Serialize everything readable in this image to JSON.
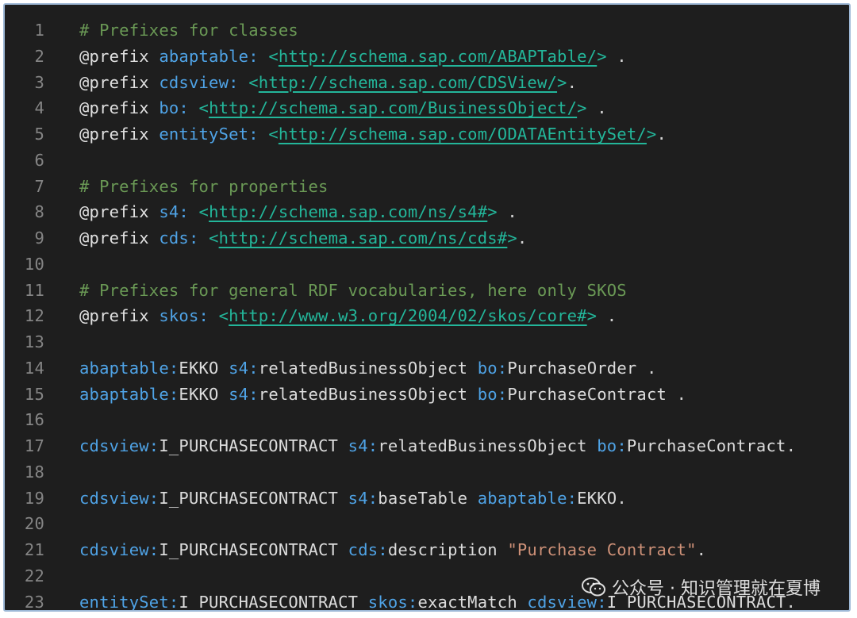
{
  "lines": [
    {
      "num": "1",
      "tokens": [
        {
          "t": "# Prefixes for classes",
          "c": "comment"
        }
      ]
    },
    {
      "num": "2",
      "tokens": [
        {
          "t": "@prefix",
          "c": "kw"
        },
        {
          "t": " ",
          "c": "punct"
        },
        {
          "t": "abaptable:",
          "c": "ns"
        },
        {
          "t": " ",
          "c": "punct"
        },
        {
          "t": "<",
          "c": "bracket"
        },
        {
          "t": "http://schema.sap.com/ABAPTable/",
          "c": "iri"
        },
        {
          "t": ">",
          "c": "bracket"
        },
        {
          "t": " .",
          "c": "punct"
        }
      ]
    },
    {
      "num": "3",
      "tokens": [
        {
          "t": "@prefix",
          "c": "kw"
        },
        {
          "t": " ",
          "c": "punct"
        },
        {
          "t": "cdsview:",
          "c": "ns"
        },
        {
          "t": " ",
          "c": "punct"
        },
        {
          "t": "<",
          "c": "bracket"
        },
        {
          "t": "http://schema.sap.com/CDSView/",
          "c": "iri"
        },
        {
          "t": ">",
          "c": "bracket"
        },
        {
          "t": ".",
          "c": "punct"
        }
      ]
    },
    {
      "num": "4",
      "tokens": [
        {
          "t": "@prefix",
          "c": "kw"
        },
        {
          "t": " ",
          "c": "punct"
        },
        {
          "t": "bo:",
          "c": "ns"
        },
        {
          "t": " ",
          "c": "punct"
        },
        {
          "t": "<",
          "c": "bracket"
        },
        {
          "t": "http://schema.sap.com/BusinessObject/",
          "c": "iri"
        },
        {
          "t": ">",
          "c": "bracket"
        },
        {
          "t": " .",
          "c": "punct"
        }
      ]
    },
    {
      "num": "5",
      "tokens": [
        {
          "t": "@prefix",
          "c": "kw"
        },
        {
          "t": " ",
          "c": "punct"
        },
        {
          "t": "entitySet:",
          "c": "ns"
        },
        {
          "t": " ",
          "c": "punct"
        },
        {
          "t": "<",
          "c": "bracket"
        },
        {
          "t": "http://schema.sap.com/ODATAEntitySet/",
          "c": "iri"
        },
        {
          "t": ">",
          "c": "bracket"
        },
        {
          "t": ".",
          "c": "punct"
        }
      ]
    },
    {
      "num": "6",
      "tokens": []
    },
    {
      "num": "7",
      "tokens": [
        {
          "t": "# Prefixes for properties",
          "c": "comment"
        }
      ]
    },
    {
      "num": "8",
      "tokens": [
        {
          "t": "@prefix",
          "c": "kw"
        },
        {
          "t": " ",
          "c": "punct"
        },
        {
          "t": "s4:",
          "c": "ns"
        },
        {
          "t": " ",
          "c": "punct"
        },
        {
          "t": "<",
          "c": "bracket"
        },
        {
          "t": "http://schema.sap.com/ns/s4#",
          "c": "iri"
        },
        {
          "t": ">",
          "c": "bracket"
        },
        {
          "t": " .",
          "c": "punct"
        }
      ]
    },
    {
      "num": "9",
      "tokens": [
        {
          "t": "@prefix",
          "c": "kw"
        },
        {
          "t": " ",
          "c": "punct"
        },
        {
          "t": "cds:",
          "c": "ns"
        },
        {
          "t": " ",
          "c": "punct"
        },
        {
          "t": "<",
          "c": "bracket"
        },
        {
          "t": "http://schema.sap.com/ns/cds#",
          "c": "iri"
        },
        {
          "t": ">",
          "c": "bracket"
        },
        {
          "t": ".",
          "c": "punct"
        }
      ]
    },
    {
      "num": "10",
      "tokens": []
    },
    {
      "num": "11",
      "tokens": [
        {
          "t": "# Prefixes for general RDF vocabularies, here only SKOS",
          "c": "comment"
        }
      ]
    },
    {
      "num": "12",
      "tokens": [
        {
          "t": "@prefix",
          "c": "kw"
        },
        {
          "t": " ",
          "c": "punct"
        },
        {
          "t": "skos:",
          "c": "ns"
        },
        {
          "t": " ",
          "c": "punct"
        },
        {
          "t": "<",
          "c": "bracket"
        },
        {
          "t": "http://www.w3.org/2004/02/skos/core#",
          "c": "iri"
        },
        {
          "t": ">",
          "c": "bracket"
        },
        {
          "t": " .",
          "c": "punct"
        }
      ]
    },
    {
      "num": "13",
      "tokens": []
    },
    {
      "num": "14",
      "tokens": [
        {
          "t": "abaptable:",
          "c": "ns"
        },
        {
          "t": "EKKO",
          "c": "id"
        },
        {
          "t": " ",
          "c": "punct"
        },
        {
          "t": "s4:",
          "c": "ns"
        },
        {
          "t": "relatedBusinessObject",
          "c": "id"
        },
        {
          "t": " ",
          "c": "punct"
        },
        {
          "t": "bo:",
          "c": "ns"
        },
        {
          "t": "PurchaseOrder",
          "c": "id"
        },
        {
          "t": " .",
          "c": "punct"
        }
      ]
    },
    {
      "num": "15",
      "tokens": [
        {
          "t": "abaptable:",
          "c": "ns"
        },
        {
          "t": "EKKO",
          "c": "id"
        },
        {
          "t": " ",
          "c": "punct"
        },
        {
          "t": "s4:",
          "c": "ns"
        },
        {
          "t": "relatedBusinessObject",
          "c": "id"
        },
        {
          "t": " ",
          "c": "punct"
        },
        {
          "t": "bo:",
          "c": "ns"
        },
        {
          "t": "PurchaseContract",
          "c": "id"
        },
        {
          "t": " .",
          "c": "punct"
        }
      ]
    },
    {
      "num": "16",
      "tokens": []
    },
    {
      "num": "17",
      "tokens": [
        {
          "t": "cdsview:",
          "c": "ns"
        },
        {
          "t": "I_PURCHASECONTRACT",
          "c": "id"
        },
        {
          "t": " ",
          "c": "punct"
        },
        {
          "t": "s4:",
          "c": "ns"
        },
        {
          "t": "relatedBusinessObject",
          "c": "id"
        },
        {
          "t": " ",
          "c": "punct"
        },
        {
          "t": "bo:",
          "c": "ns"
        },
        {
          "t": "PurchaseContract",
          "c": "id"
        },
        {
          "t": ".",
          "c": "punct"
        }
      ]
    },
    {
      "num": "18",
      "tokens": []
    },
    {
      "num": "19",
      "tokens": [
        {
          "t": "cdsview:",
          "c": "ns"
        },
        {
          "t": "I_PURCHASECONTRACT",
          "c": "id"
        },
        {
          "t": " ",
          "c": "punct"
        },
        {
          "t": "s4:",
          "c": "ns"
        },
        {
          "t": "baseTable",
          "c": "id"
        },
        {
          "t": " ",
          "c": "punct"
        },
        {
          "t": "abaptable:",
          "c": "ns"
        },
        {
          "t": "EKKO",
          "c": "id"
        },
        {
          "t": ".",
          "c": "punct"
        }
      ]
    },
    {
      "num": "20",
      "tokens": []
    },
    {
      "num": "21",
      "tokens": [
        {
          "t": "cdsview:",
          "c": "ns"
        },
        {
          "t": "I_PURCHASECONTRACT",
          "c": "id"
        },
        {
          "t": " ",
          "c": "punct"
        },
        {
          "t": "cds:",
          "c": "ns"
        },
        {
          "t": "description",
          "c": "id"
        },
        {
          "t": " ",
          "c": "punct"
        },
        {
          "t": "\"Purchase Contract\"",
          "c": "str"
        },
        {
          "t": ".",
          "c": "punct"
        }
      ]
    },
    {
      "num": "22",
      "tokens": []
    },
    {
      "num": "23",
      "tokens": [
        {
          "t": "entitySet:",
          "c": "ns"
        },
        {
          "t": "I_PURCHASECONTRACT",
          "c": "id"
        },
        {
          "t": " ",
          "c": "punct"
        },
        {
          "t": "skos:",
          "c": "ns"
        },
        {
          "t": "exactMatch",
          "c": "id"
        },
        {
          "t": " ",
          "c": "punct"
        },
        {
          "t": "cdsview:",
          "c": "ns"
        },
        {
          "t": "I_PURCHASECONTRACT",
          "c": "id"
        },
        {
          "t": ".",
          "c": "punct"
        }
      ]
    }
  ],
  "watermark": {
    "text": "公众号 · 知识管理就在夏博",
    "icon": "wechat-icon"
  },
  "colors": {
    "background": "#1e1e1e",
    "border": "#9db8d6",
    "comment": "#6a9955",
    "namespace": "#4fa3e6",
    "iri": "#23b69a",
    "string": "#ce9178",
    "line_number": "#858585"
  }
}
